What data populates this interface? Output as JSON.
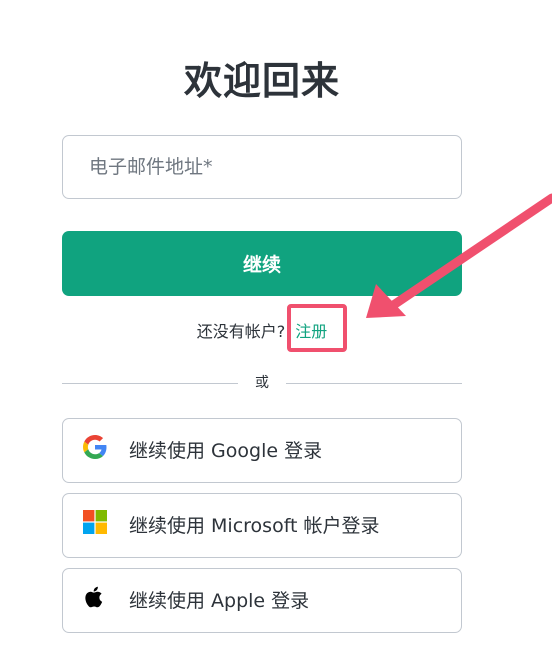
{
  "title": "欢迎回来",
  "email": {
    "placeholder": "电子邮件地址*",
    "value": ""
  },
  "continue_label": "继续",
  "signup": {
    "prompt": "还没有帐户?",
    "link_label": "注册"
  },
  "divider_label": "或",
  "social": {
    "google_label": "继续使用 Google 登录",
    "microsoft_label": "继续使用 Microsoft 帐户登录",
    "apple_label": "继续使用 Apple 登录"
  },
  "colors": {
    "accent": "#10a37f",
    "annotation": "#f0506e",
    "border": "#c2c8d0",
    "text": "#2d333a"
  },
  "icons": {
    "google": "google-icon",
    "microsoft": "microsoft-icon",
    "apple": "apple-icon",
    "annotation_arrow": "arrow-icon"
  }
}
